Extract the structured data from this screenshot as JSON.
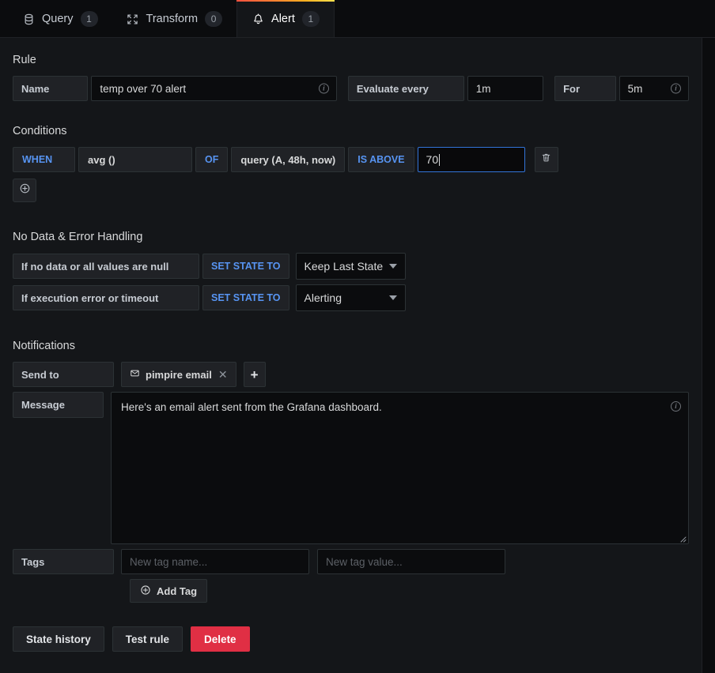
{
  "tabs": [
    {
      "label": "Query",
      "count": "1",
      "icon": "database-icon",
      "active": false
    },
    {
      "label": "Transform",
      "count": "0",
      "icon": "transform-icon",
      "active": false
    },
    {
      "label": "Alert",
      "count": "1",
      "icon": "bell-icon",
      "active": true
    }
  ],
  "rule": {
    "section_title": "Rule",
    "name_label": "Name",
    "name_value": "temp over 70 alert",
    "evaluate_label": "Evaluate every",
    "evaluate_value": "1m",
    "for_label": "For",
    "for_value": "5m"
  },
  "conditions": {
    "section_title": "Conditions",
    "when": "WHEN",
    "reducer": "avg ()",
    "of": "OF",
    "query": "query (A, 48h, now)",
    "evaluator": "IS ABOVE",
    "threshold": "70",
    "delete_icon": "trash-icon",
    "add_icon": "plus-circle-icon"
  },
  "no_data": {
    "section_title": "No Data & Error Handling",
    "rows": [
      {
        "label": "If no data or all values are null",
        "set_state": "SET STATE TO",
        "value": "Keep Last State"
      },
      {
        "label": "If execution error or timeout",
        "set_state": "SET STATE TO",
        "value": "Alerting"
      }
    ]
  },
  "notifications": {
    "section_title": "Notifications",
    "send_to_label": "Send to",
    "channel": "pimpire email",
    "channel_icon": "envelope-icon",
    "remove_icon": "close-icon",
    "add_channel_label": "+",
    "message_label": "Message",
    "message_value": "Here's an email alert sent from the Grafana dashboard.",
    "tags_label": "Tags",
    "tag_name_placeholder": "New tag name...",
    "tag_name_value": "",
    "tag_value_placeholder": "New tag value...",
    "tag_value_value": "",
    "add_tag_label": "Add Tag"
  },
  "footer": {
    "state_history": "State history",
    "test_rule": "Test rule",
    "delete": "Delete"
  },
  "colors": {
    "background": "#141619",
    "tabbar_background": "#0b0c0e",
    "accent_blue": "#5794f2",
    "focus_blue": "#3274d9",
    "danger_red": "#e02f44",
    "panel_border": "#2c3235"
  }
}
